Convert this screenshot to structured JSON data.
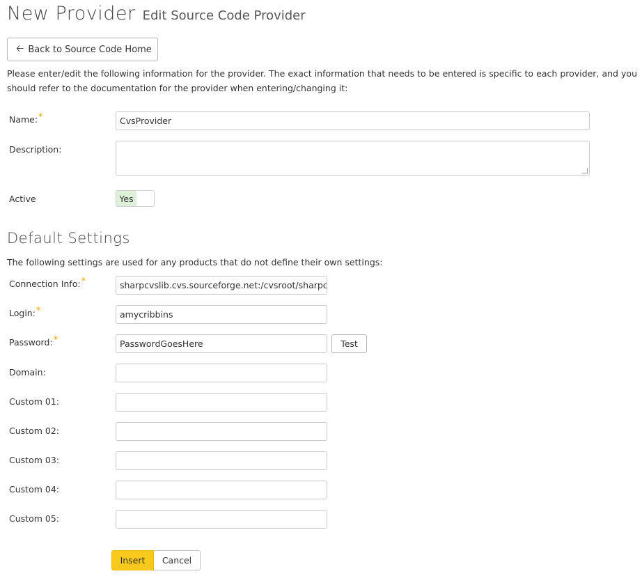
{
  "header": {
    "title": "New Provider",
    "subtitle": "Edit Source Code Provider"
  },
  "back_button": {
    "label": "Back to Source Code Home",
    "icon": "arrow-left-icon"
  },
  "intro": "Please enter/edit the following information for the provider. The exact information that needs to be entered is specific to each provider, and you should refer to the documentation for the provider when entering/changing it:",
  "form": {
    "name": {
      "label": "Name:",
      "value": "CvsProvider",
      "required": true
    },
    "description": {
      "label": "Description:",
      "value": ""
    },
    "active": {
      "label": "Active",
      "value": "Yes"
    }
  },
  "default_settings": {
    "title": "Default Settings",
    "description": "The following settings are used for any products that do not define their own settings:",
    "connection_info": {
      "label": "Connection Info:",
      "value": "sharpcvslib.cvs.sourceforge.net:/cvsroot/sharpcvslib",
      "required": true
    },
    "login": {
      "label": "Login:",
      "value": "amycribbins",
      "required": true
    },
    "password": {
      "label": "Password:",
      "value": "PasswordGoesHere",
      "required": true
    },
    "test_button": "Test",
    "domain": {
      "label": "Domain:",
      "value": ""
    },
    "custom_01": {
      "label": "Custom 01:",
      "value": ""
    },
    "custom_02": {
      "label": "Custom 02:",
      "value": ""
    },
    "custom_03": {
      "label": "Custom 03:",
      "value": ""
    },
    "custom_04": {
      "label": "Custom 04:",
      "value": ""
    },
    "custom_05": {
      "label": "Custom 05:",
      "value": ""
    }
  },
  "actions": {
    "insert": "Insert",
    "cancel": "Cancel"
  },
  "colors": {
    "required_star": "#f0a500",
    "insert_button": "#f8c91c",
    "toggle_on": "#dff0d8"
  }
}
